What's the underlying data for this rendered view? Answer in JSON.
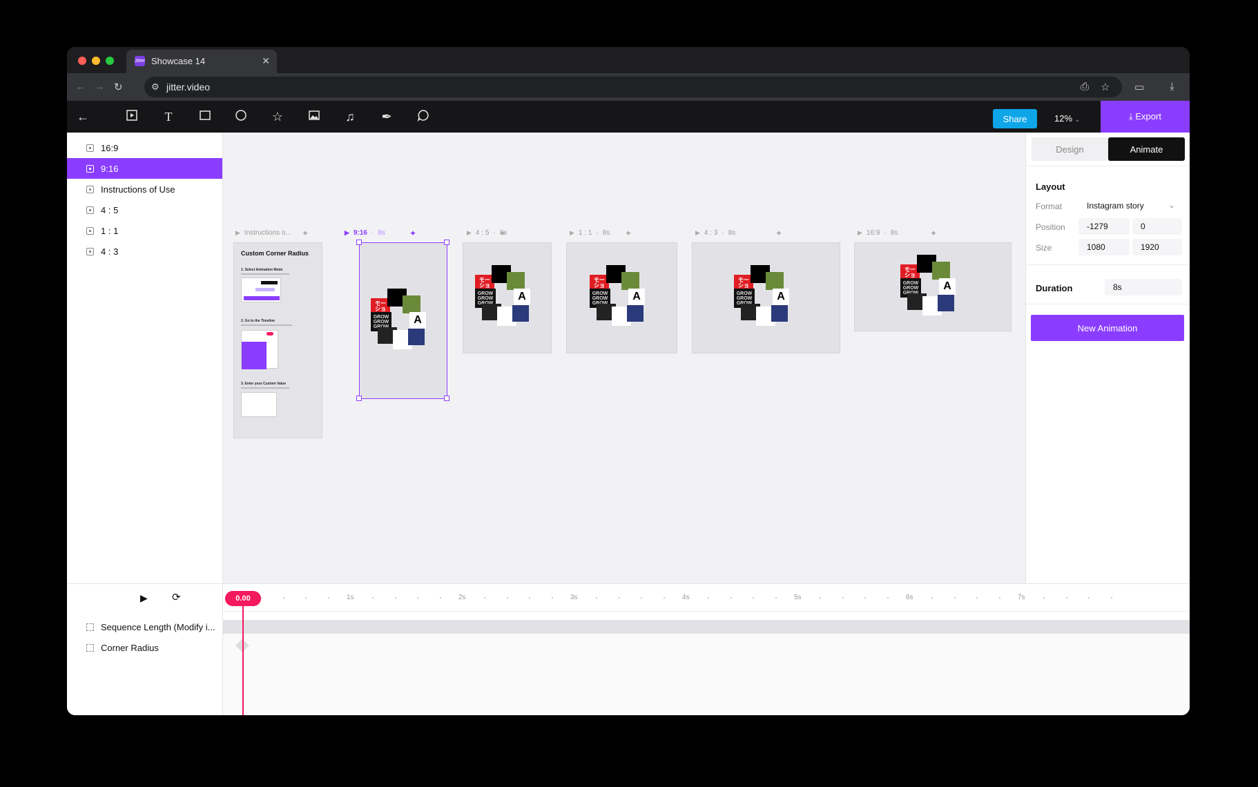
{
  "browser": {
    "tab_title": "Showcase 14",
    "favicon_text": "Jitter",
    "url": "jitter.video"
  },
  "toolbar": {
    "share_label": "Share",
    "zoom_label": "12%",
    "export_label": "Export"
  },
  "layers": [
    {
      "label": "16:9"
    },
    {
      "label": "9:16",
      "active": true
    },
    {
      "label": "Instructions of Use"
    },
    {
      "label": "4 : 5"
    },
    {
      "label": "1 : 1"
    },
    {
      "label": "4 : 3"
    }
  ],
  "artboards": {
    "instructions": {
      "label": "Instructions o...",
      "title": "Custom Corner Radius",
      "step1": "1. Select Animation Mode",
      "step2": "2. Go to the Timeline",
      "step3": "3. Enter your Custom Value"
    },
    "a916": {
      "label": "9:16",
      "duration": "8s"
    },
    "a45": {
      "label": "4 : 5",
      "duration": "8s"
    },
    "a11": {
      "label": "1 : 1",
      "duration": "8s"
    },
    "a43": {
      "label": "4 : 3",
      "duration": "8s"
    },
    "a169": {
      "label": "16:9",
      "duration": "8s"
    },
    "collage_glyph_a": "A",
    "collage_glyph_jp1": "モー",
    "collage_glyph_jp2": "ショ",
    "collage_grow": "GROW"
  },
  "panel": {
    "tab_design": "Design",
    "tab_animate": "Animate",
    "layout_title": "Layout",
    "format_label": "Format",
    "format_value": "Instagram story",
    "position_label": "Position",
    "position_x": "-1279",
    "position_y": "0",
    "size_label": "Size",
    "size_w": "1080",
    "size_h": "1920",
    "duration_label": "Duration",
    "duration_value": "8s",
    "new_animation_label": "New Animation"
  },
  "timeline": {
    "playhead": "0.00",
    "ticks": [
      "1s",
      "2s",
      "3s",
      "4s",
      "5s",
      "6s",
      "7s"
    ],
    "rows": [
      {
        "label": "Sequence Length (Modify i..."
      },
      {
        "label": "Corner Radius"
      }
    ]
  },
  "colors": {
    "accent": "#8b3dff",
    "share": "#0ea5e9",
    "playhead": "#f5195d"
  }
}
